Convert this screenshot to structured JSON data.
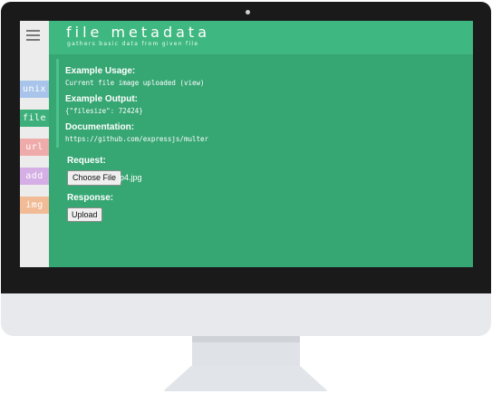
{
  "header": {
    "title": "file metadata",
    "subtitle": "gathers basic data from given file"
  },
  "sidebar": {
    "menu_icon": "hamburger-menu-icon",
    "tabs": [
      {
        "label": "unix",
        "color": "#a9c4ea"
      },
      {
        "label": "file",
        "color": "#3daf7a",
        "active": true
      },
      {
        "label": "url",
        "color": "#efaaaa"
      },
      {
        "label": "add",
        "color": "#d4aee4"
      },
      {
        "label": "img",
        "color": "#f1bb96"
      }
    ]
  },
  "info": {
    "usage_label": "Example Usage:",
    "usage_value": "Current file image uploaded (view)",
    "output_label": "Example Output:",
    "output_value": "{\"filesize\": 72424}",
    "docs_label": "Documentation:",
    "docs_value": "https://github.com/expressjs/multer"
  },
  "form": {
    "request_label": "Request:",
    "choose_button": "Choose File",
    "file_name": "p4.jpg",
    "response_label": "Response:",
    "upload_button": "Upload"
  },
  "colors": {
    "accent": "#3daf7a",
    "header": "#3fb780",
    "content": "#36a673"
  }
}
